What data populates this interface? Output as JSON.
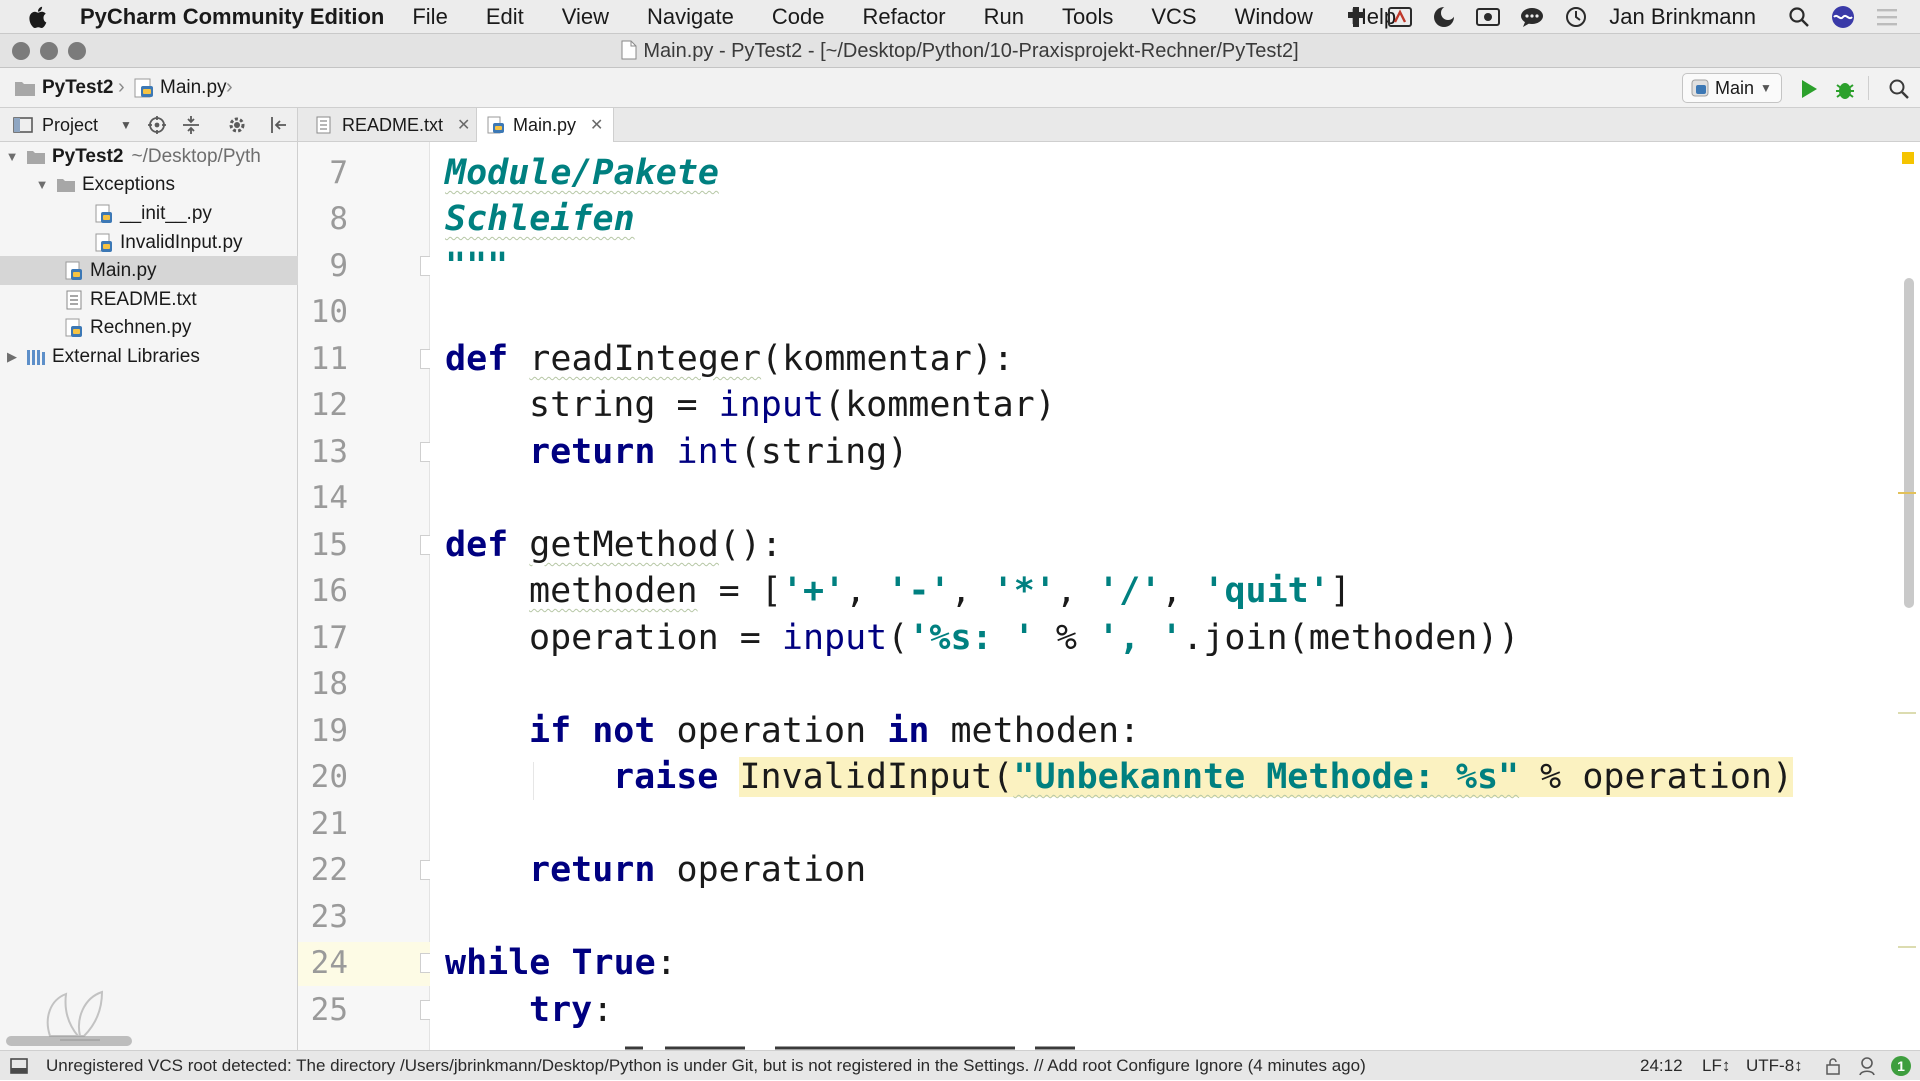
{
  "colors": {
    "keyword": "#000080",
    "string": "#008080",
    "highlight": "#fbf2c1",
    "current_line": "#fdfbe5",
    "run_green": "#2ca02c"
  },
  "menubar": {
    "app_name": "PyCharm Community Edition",
    "items": [
      "File",
      "Edit",
      "View",
      "Navigate",
      "Code",
      "Refactor",
      "Run",
      "Tools",
      "VCS",
      "Window",
      "Help"
    ],
    "user": "Jan Brinkmann"
  },
  "window": {
    "title": "Main.py - PyTest2 - [~/Desktop/Python/10-Praxisprojekt-Rechner/PyTest2]"
  },
  "navbar": {
    "crumbs": [
      "PyTest2",
      "Main.py"
    ],
    "run_config": "Main"
  },
  "project_panel": {
    "view_selector": "Project",
    "tree": [
      {
        "label": "PyTest2",
        "path": "~/Desktop/Pyth"
      },
      {
        "label": "Exceptions"
      },
      {
        "label": "__init__.py"
      },
      {
        "label": "InvalidInput.py"
      },
      {
        "label": "Main.py"
      },
      {
        "label": "README.txt"
      },
      {
        "label": "Rechnen.py"
      },
      {
        "label": "External Libraries"
      }
    ]
  },
  "tabs": [
    {
      "label": "README.txt",
      "active": false
    },
    {
      "label": "Main.py",
      "active": true
    }
  ],
  "editor": {
    "line_numbers": [
      "7",
      "8",
      "9",
      "10",
      "11",
      "12",
      "13",
      "14",
      "15",
      "16",
      "17",
      "18",
      "19",
      "20",
      "21",
      "22",
      "23",
      "24",
      "25"
    ],
    "current_line": "24",
    "lines": {
      "l7": "Module/Pakete",
      "l8": "Schleifen",
      "l9": "\"\"\"",
      "l11_def": "def",
      "l11_name": "readInteger",
      "l11_rest": "(kommentar):",
      "l12_pre": "string = ",
      "l12_fn": "input",
      "l12_rest": "(kommentar)",
      "l13_kw": "return",
      "l13_fn": "int",
      "l13_rest": "(string)",
      "l15_def": "def",
      "l15_name": "getMethod",
      "l15_rest": "():",
      "l16_name": "methoden",
      "l16_pre": " = [",
      "l16_s1": "'+'",
      "l16_s2": "'-'",
      "l16_s3": "'*'",
      "l16_s4": "'/'",
      "l16_s5": "'quit'",
      "l16_end": "]",
      "l17_pre": "operation = ",
      "l17_fn": "input",
      "l17_open": "(",
      "l17_s1": "'%s: '",
      "l17_mid": " % ",
      "l17_s2": "', '",
      "l17_rest": ".join(methoden))",
      "l19_if": "if",
      "l19_not": "not",
      "l19_mid": " operation ",
      "l19_in": "in",
      "l19_rest": " methoden:",
      "l20_kw": "raise",
      "l20_cls": "InvalidInput(",
      "l20_str": "\"Unbekannte Methode: %s\"",
      "l20_rest": " % operation)",
      "l22_kw": "return",
      "l22_rest": " operation",
      "l24_while": "while",
      "l24_true": "True",
      "l24_rest": ":",
      "l25_kw": "try",
      "l25_rest": ":"
    }
  },
  "statusbar": {
    "message": "Unregistered VCS root detected: The directory /Users/jbrinkmann/Desktop/Python is under Git, but is not registered in the Settings. // Add root  Configure  Ignore (4 minutes ago)",
    "position": "24:12",
    "line_separator": "LF↕",
    "encoding": "UTF-8↕",
    "event_count": "1"
  }
}
